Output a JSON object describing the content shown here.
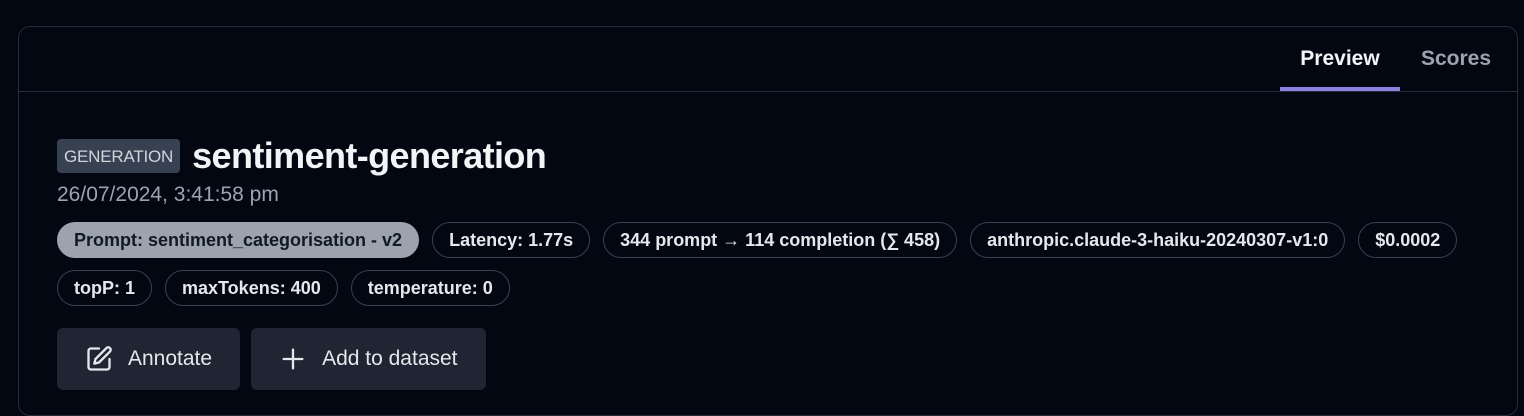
{
  "tabs": {
    "preview": "Preview",
    "scores": "Scores"
  },
  "observation": {
    "type_badge": "GENERATION",
    "name": "sentiment-generation",
    "timestamp": "26/07/2024, 3:41:58 pm",
    "badges": {
      "prompt": "Prompt: sentiment_categorisation - v2",
      "latency": "Latency: 1.77s",
      "tokens": "344 prompt → 114 completion (∑ 458)",
      "model": "anthropic.claude-3-haiku-20240307-v1:0",
      "cost": "$0.0002",
      "top_p": "topP: 1",
      "max_tokens": "maxTokens: 400",
      "temperature": "temperature: 0"
    }
  },
  "actions": {
    "annotate": "Annotate",
    "add_to_dataset": "Add to dataset"
  },
  "icons": {
    "annotate": "edit-square-icon",
    "add": "plus-icon"
  },
  "colors": {
    "background": "#030712",
    "active_tab_indicator": "#8b7fe0",
    "prompt_badge_bg": "#9ca3af"
  }
}
